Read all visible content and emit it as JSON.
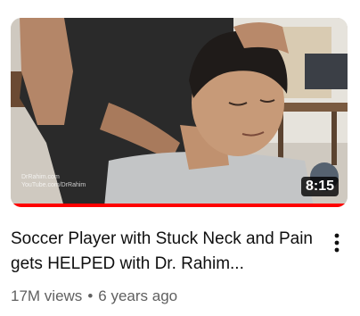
{
  "video": {
    "title": "Soccer Player with Stuck Neck and Pain gets HELPED with Dr. Rahim...",
    "duration": "8:15",
    "views": "17M views",
    "separator": "•",
    "age": "6 years ago",
    "watch_progress": 1.0,
    "watermark_line1": "DrRahim.com",
    "watermark_line2": "YouTube.com/DrRahim"
  },
  "icons": {
    "menu": "more-vertical-icon"
  },
  "colors": {
    "progress": "#ff0000",
    "title_text": "#0f0f0f",
    "meta_text": "#606060"
  }
}
